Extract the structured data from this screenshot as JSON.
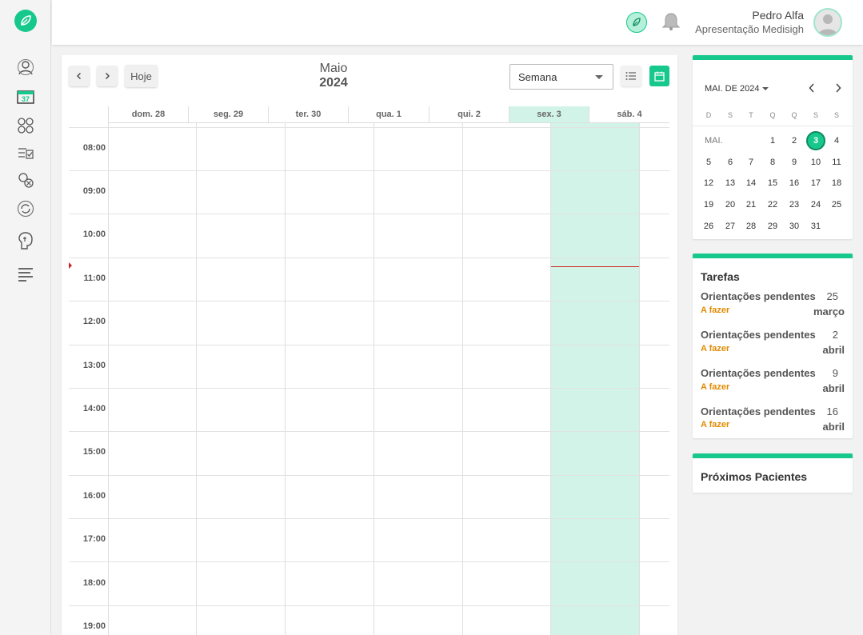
{
  "header": {
    "user_name": "Pedro Alfa",
    "user_subtitle": "Apresentação Medisigh"
  },
  "calendar": {
    "month": "Maio",
    "year": "2024",
    "today_label": "Hoje",
    "view_select": "Semana",
    "days": [
      "dom. 28",
      "seg. 29",
      "ter. 30",
      "qua. 1",
      "qui. 2",
      "sex. 3",
      "sáb. 4"
    ],
    "hours": [
      "08:00",
      "09:00",
      "10:00",
      "11:00",
      "12:00",
      "13:00",
      "14:00",
      "15:00",
      "16:00",
      "17:00",
      "18:00",
      "19:00"
    ]
  },
  "mini_calendar": {
    "month_label": "MAI. DE 2024",
    "weekdays": [
      "D",
      "S",
      "T",
      "Q",
      "Q",
      "S",
      "S"
    ],
    "row_label": "MAI.",
    "selected_day": "3",
    "week1": [
      "1",
      "2",
      "3",
      "4"
    ],
    "week2": [
      "5",
      "6",
      "7",
      "8",
      "9",
      "10",
      "11"
    ],
    "week3": [
      "12",
      "13",
      "14",
      "15",
      "16",
      "17",
      "18"
    ],
    "week4": [
      "19",
      "20",
      "21",
      "22",
      "23",
      "24",
      "25"
    ],
    "week5": [
      "26",
      "27",
      "28",
      "29",
      "30",
      "31"
    ]
  },
  "tasks": {
    "title": "Tarefas",
    "items": [
      {
        "title": "Orientações pendentes",
        "status": "A fazer",
        "day": "25",
        "month": "março"
      },
      {
        "title": "Orientações pendentes",
        "status": "A fazer",
        "day": "2",
        "month": "abril"
      },
      {
        "title": "Orientações pendentes",
        "status": "A fazer",
        "day": "9",
        "month": "abril"
      },
      {
        "title": "Orientações pendentes",
        "status": "A fazer",
        "day": "16",
        "month": "abril"
      }
    ]
  },
  "next_patients": {
    "title": "Próximos Pacientes"
  },
  "colors": {
    "accent": "#17c88d",
    "today_column": "#d2f4e8",
    "now_line": "#d42020",
    "task_status": "#e08a00"
  },
  "icons": {
    "sidebar": [
      "user-icon",
      "calendar-37-icon",
      "medicines-icon",
      "checklist-icon",
      "cancel-icon",
      "refresh-icon",
      "brain-icon",
      "reports-icon"
    ]
  }
}
